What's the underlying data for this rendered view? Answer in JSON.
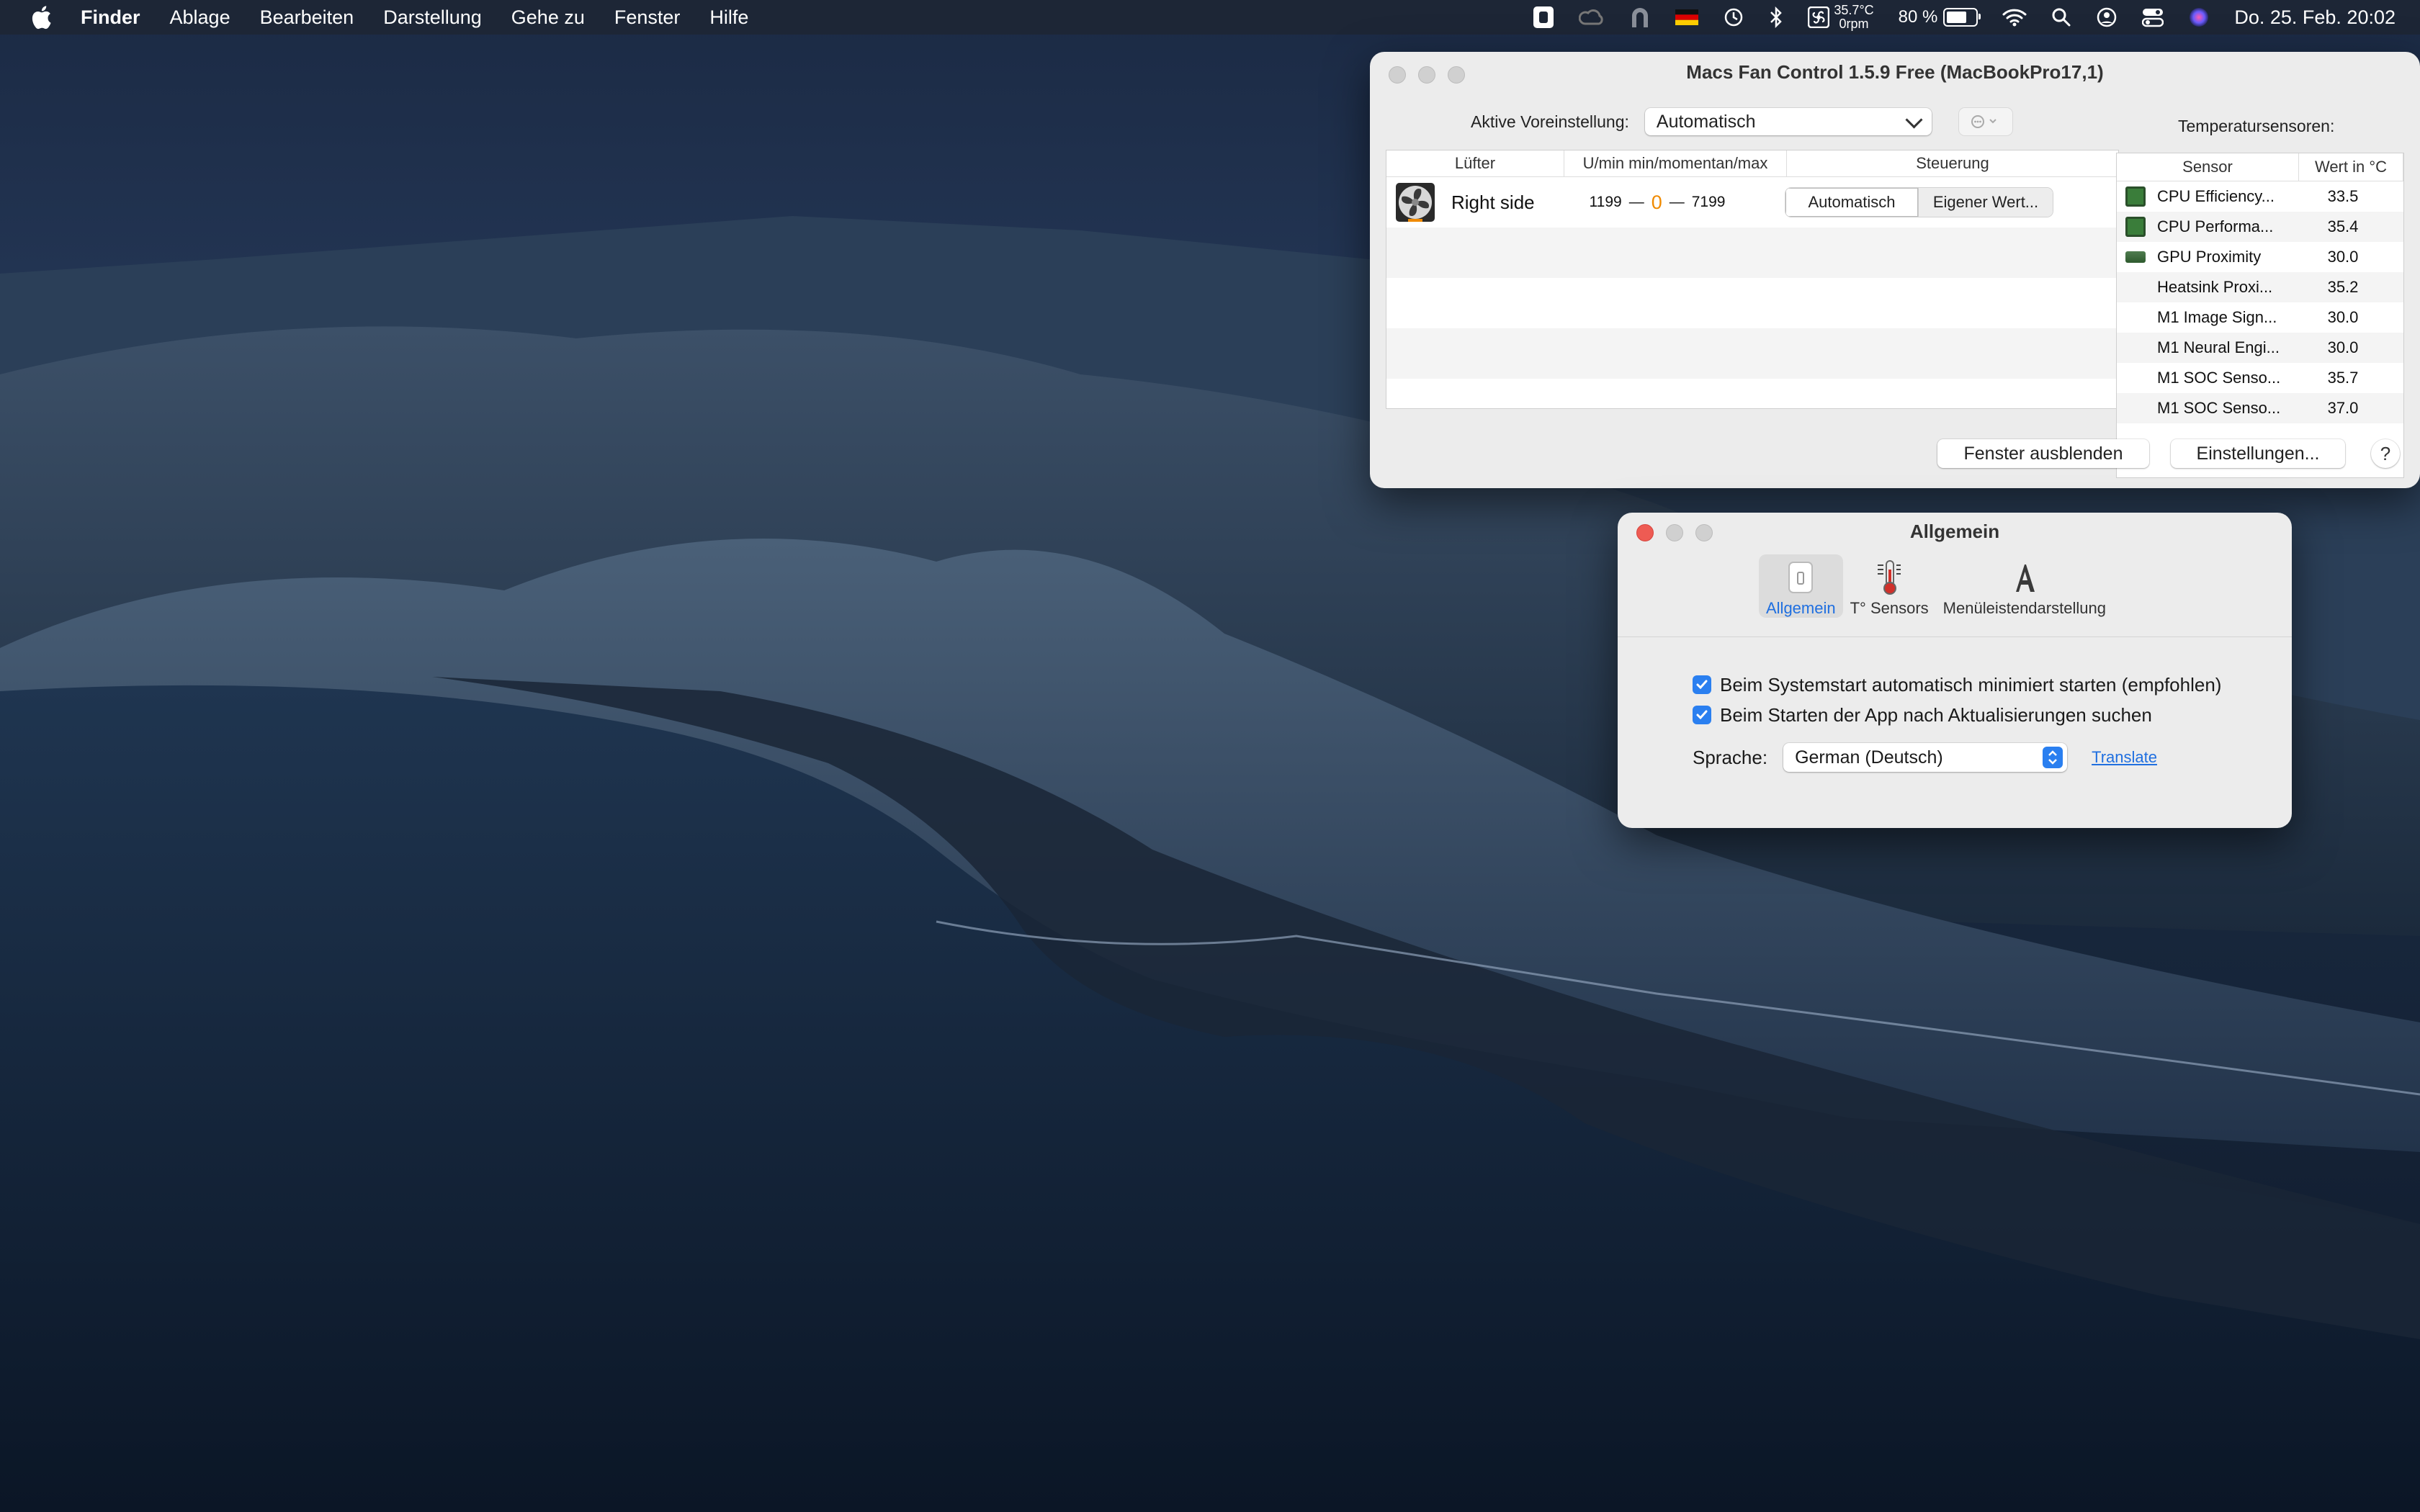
{
  "menubar": {
    "app_name": "Finder",
    "items": [
      "Ablage",
      "Bearbeiten",
      "Darstellung",
      "Gehe zu",
      "Fenster",
      "Hilfe"
    ],
    "status": {
      "temp_top": "35.7°C",
      "temp_bottom": "0rpm",
      "battery_percent": "80 %",
      "battery_level": 0.8,
      "datetime": "Do. 25. Feb.  20:02"
    },
    "icons": [
      "apple-logo-icon",
      "shortcut-icon",
      "creative-cloud-icon",
      "vpn-icon",
      "flag-germany-icon",
      "time-machine-icon",
      "bluetooth-icon",
      "fan-control-icon",
      "battery-icon",
      "wifi-icon",
      "spotlight-icon",
      "user-icon",
      "control-center-icon",
      "siri-icon"
    ]
  },
  "fan_window": {
    "title": "Macs Fan Control 1.5.9 Free (MacBookPro17,1)",
    "preset_label": "Aktive Voreinstellung:",
    "preset_value": "Automatisch",
    "temp_sensors_label": "Temperatursensoren:",
    "fan_table": {
      "columns": [
        "Lüfter",
        "U/min min/momentan/max",
        "Steuerung"
      ],
      "fans": [
        {
          "name": "Right side",
          "min": "1199",
          "current": "0",
          "max": "7199",
          "control_auto": "Automatisch",
          "control_custom": "Eigener Wert..."
        }
      ]
    },
    "sensor_table": {
      "columns": [
        "Sensor",
        "Wert in °C"
      ],
      "rows": [
        {
          "name": "CPU Efficiency...",
          "value": "33.5",
          "icon": "cpu-chip-icon"
        },
        {
          "name": "CPU Performa...",
          "value": "35.4",
          "icon": "cpu-chip-icon"
        },
        {
          "name": "GPU Proximity",
          "value": "30.0",
          "icon": "gpu-card-icon"
        },
        {
          "name": "Heatsink Proxi...",
          "value": "35.2",
          "icon": ""
        },
        {
          "name": "M1 Image Sign...",
          "value": "30.0",
          "icon": ""
        },
        {
          "name": "M1 Neural Engi...",
          "value": "30.0",
          "icon": ""
        },
        {
          "name": "M1 SOC Senso...",
          "value": "35.7",
          "icon": ""
        },
        {
          "name": "M1 SOC Senso...",
          "value": "37.0",
          "icon": ""
        }
      ]
    },
    "buttons": {
      "hide": "Fenster ausblenden",
      "settings": "Einstellungen...",
      "help": "?"
    }
  },
  "prefs_window": {
    "title": "Allgemein",
    "tabs": [
      {
        "label": "Allgemein",
        "icon": "general-switch-icon",
        "selected": true
      },
      {
        "label": "T° Sensors",
        "icon": "thermometer-icon",
        "selected": false
      },
      {
        "label": "Menüleistendarstellung",
        "icon": "font-a-icon",
        "selected": false
      }
    ],
    "checkboxes": [
      {
        "label": "Beim Systemstart automatisch minimiert starten (empfohlen)",
        "checked": true
      },
      {
        "label": "Beim Starten der App nach Aktualisierungen suchen",
        "checked": true
      }
    ],
    "language_label": "Sprache:",
    "language_value": "German (Deutsch)",
    "translate_link": "Translate"
  },
  "colors": {
    "accent": "#2a7ff0",
    "rpm_current": "#f08a00",
    "close_red": "#ee5b53"
  }
}
